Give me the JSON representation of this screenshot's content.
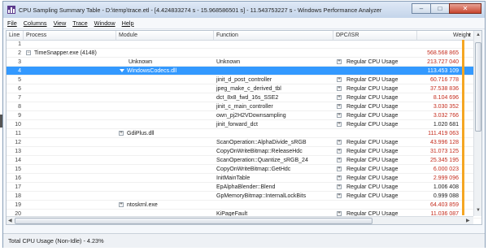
{
  "window": {
    "title": "CPU Sampling Summary Table - D:\\temp\\trace.etl - [4.424833274 s - 15.968586501 s] - 11.543753227 s - Windows Performance Analyzer",
    "buttons": {
      "minimize": "–",
      "maximize": "□",
      "close": "✕"
    }
  },
  "menu": [
    "File",
    "Columns",
    "View",
    "Trace",
    "Window",
    "Help"
  ],
  "columns": {
    "line": "Line",
    "process": "Process",
    "module": "Module",
    "function": "Function",
    "dpc": "DPC/ISR",
    "weight": "Weight"
  },
  "rows": [
    {
      "line": "1",
      "process": "",
      "module": "",
      "function": "",
      "dpc": "",
      "weight": "",
      "weight_color": "black"
    },
    {
      "line": "2",
      "process": "TimeSnapper.exe (4148)",
      "module": "",
      "function": "",
      "dpc": "",
      "weight": "568.568 865",
      "weight_color": "red"
    },
    {
      "line": "3",
      "process": "",
      "module": "Unknown",
      "function": "Unknown",
      "dpc": "Regular CPU Usage",
      "weight": "213.727 040",
      "weight_color": "red"
    },
    {
      "line": "4",
      "process": "",
      "module": "WindowsCodecs.dll",
      "function": "",
      "dpc": "",
      "weight": "113.453 109",
      "weight_color": "red"
    },
    {
      "line": "5",
      "process": "",
      "module": "",
      "function": "jinit_d_post_controller",
      "dpc": "Regular CPU Usage",
      "weight": "60.716 778",
      "weight_color": "red"
    },
    {
      "line": "6",
      "process": "",
      "module": "",
      "function": "jpeg_make_c_derived_tbl",
      "dpc": "Regular CPU Usage",
      "weight": "37.538 836",
      "weight_color": "red"
    },
    {
      "line": "7",
      "process": "",
      "module": "",
      "function": "dct_8x8_fwd_16s_SSE2",
      "dpc": "Regular CPU Usage",
      "weight": "8.104 696",
      "weight_color": "red"
    },
    {
      "line": "8",
      "process": "",
      "module": "",
      "function": "jinit_c_main_controller",
      "dpc": "Regular CPU Usage",
      "weight": "3.030 352",
      "weight_color": "red"
    },
    {
      "line": "9",
      "process": "",
      "module": "",
      "function": "own_pj2H2VDownsampling",
      "dpc": "Regular CPU Usage",
      "weight": "3.032 766",
      "weight_color": "red"
    },
    {
      "line": "10",
      "process": "",
      "module": "",
      "function": "jinit_forward_dct",
      "dpc": "Regular CPU Usage",
      "weight": "1.020 681",
      "weight_color": "black"
    },
    {
      "line": "11",
      "process": "",
      "module": "GdiPlus.dll",
      "function": "",
      "dpc": "",
      "weight": "111.419 063",
      "weight_color": "red"
    },
    {
      "line": "12",
      "process": "",
      "module": "",
      "function": "ScanOperation::AlphaDivide_sRGB",
      "dpc": "Regular CPU Usage",
      "weight": "43.996 128",
      "weight_color": "red"
    },
    {
      "line": "13",
      "process": "",
      "module": "",
      "function": "CopyOnWriteBitmap::ReleaseHdc",
      "dpc": "Regular CPU Usage",
      "weight": "31.073 125",
      "weight_color": "red"
    },
    {
      "line": "14",
      "process": "",
      "module": "",
      "function": "ScanOperation::Quantize_sRGB_24",
      "dpc": "Regular CPU Usage",
      "weight": "25.345 195",
      "weight_color": "red"
    },
    {
      "line": "15",
      "process": "",
      "module": "",
      "function": "CopyOnWriteBitmap::GetHdc",
      "dpc": "Regular CPU Usage",
      "weight": "6.000 023",
      "weight_color": "red"
    },
    {
      "line": "16",
      "process": "",
      "module": "",
      "function": "InitMainTable",
      "dpc": "Regular CPU Usage",
      "weight": "2.999 096",
      "weight_color": "red"
    },
    {
      "line": "17",
      "process": "",
      "module": "",
      "function": "EpAlphaBlender::Blend",
      "dpc": "Regular CPU Usage",
      "weight": "1.006 408",
      "weight_color": "black"
    },
    {
      "line": "18",
      "process": "",
      "module": "",
      "function": "GpMemoryBitmap::InternalLockBits",
      "dpc": "Regular CPU Usage",
      "weight": "0.999 088",
      "weight_color": "black"
    },
    {
      "line": "19",
      "process": "",
      "module": "ntoskrnl.exe",
      "function": "",
      "dpc": "",
      "weight": "64.403 859",
      "weight_color": "red"
    },
    {
      "line": "20",
      "process": "",
      "module": "",
      "function": "KiPageFault",
      "dpc": "Regular CPU Usage",
      "weight": "11.036 087",
      "weight_color": "red"
    }
  ],
  "status": {
    "text": "Total CPU Usage (Non-Idle) - 4.23%"
  },
  "colors": {
    "selection": "#3399ff",
    "weight_red": "#c42b1c",
    "weight_bar": "#f5a623"
  }
}
